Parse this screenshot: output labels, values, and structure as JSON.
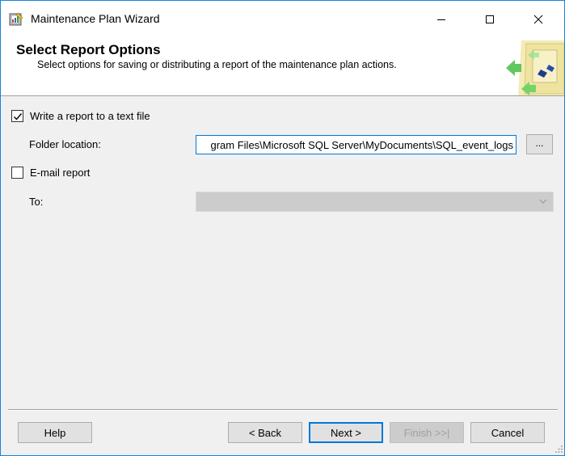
{
  "window": {
    "title": "Maintenance Plan Wizard"
  },
  "header": {
    "title": "Select Report Options",
    "subtitle": "Select options for saving or distributing a report of the maintenance plan actions."
  },
  "text_report": {
    "label": "Write a report to a text file",
    "checked": true,
    "folder_label": "Folder location:",
    "folder_value": "gram Files\\Microsoft SQL Server\\MyDocuments\\SQL_event_logs",
    "browse_label": "..."
  },
  "email_report": {
    "label": "E-mail report",
    "checked": false,
    "to_label": "To:",
    "to_value": ""
  },
  "buttons": {
    "help": "Help",
    "back": "< Back",
    "next": "Next >",
    "finish": "Finish >>|",
    "cancel": "Cancel"
  },
  "colors": {
    "accent": "#0078d7",
    "window_border": "#1883d7"
  }
}
